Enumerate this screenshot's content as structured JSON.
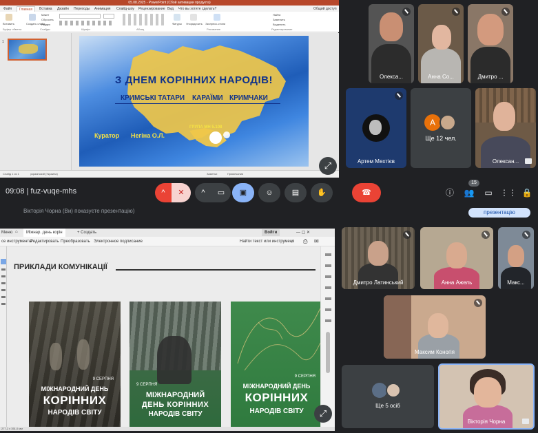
{
  "top": {
    "ppt": {
      "window_title": "05.08.2025 - PowerPoint (Сбой активации продукта)",
      "tabs": [
        "Файл",
        "Главная",
        "Вставка",
        "Дизайн",
        "Переходы",
        "Анимация",
        "Слайд-шоу",
        "Рецензирование",
        "Вид",
        "Что вы хотите сделать?"
      ],
      "share_label": "Общий доступ",
      "ribbon_groups": [
        "Буфер обмена",
        "Слайды",
        "Шрифт",
        "Абзац",
        "Рисование",
        "Редактирование"
      ],
      "ribbon_buttons": [
        "Вставить",
        "Создать слайд",
        "Макет",
        "Сбросить",
        "Раздел",
        "Фигуры",
        "Упорядочить",
        "Экспресс-стили",
        "Найти",
        "Заменить",
        "Выделить"
      ],
      "thumb_number": "1",
      "status_left": "Слайд 1 из 1",
      "status_lang": "украинский (Украина)",
      "status_right": [
        "Заметки",
        "Примечания"
      ]
    },
    "slide": {
      "headline": "З ДНЕМ КОРІННИХ НАРОДІВ!",
      "peoples": [
        "КРИМСЬКІ ТАТАРИ",
        "КАРАЇМИ",
        "КРИМЧАКИ"
      ],
      "group": "ГРУПА МН 5.108",
      "curator_label": "Куратор",
      "curator_name": "Негіна О.Л."
    },
    "participants": [
      {
        "name": "Олекса...",
        "muted": true
      },
      {
        "name": "Анна Со...",
        "muted": true
      },
      {
        "name": "Дмитро ...",
        "muted": true
      },
      {
        "name": "Артем Мехтієв",
        "muted": true
      },
      {
        "name": "Ще 12 чел.",
        "muted": false,
        "avatar_letter": "А"
      },
      {
        "name": "Олексан...",
        "muted": false
      }
    ],
    "controls": {
      "time": "09:08",
      "code": "fuz-vuqe-mhs",
      "people_count": "15"
    }
  },
  "bottom": {
    "banner_text": "Вікторія Чорна (Ви) показуєте презентацію)",
    "stop_present_label": "презентацію",
    "acrobat": {
      "tabs": [
        "Меню",
        "Міжнар. день корін",
        "+ Создать"
      ],
      "sign_in": "Войти",
      "toolbar": [
        "се инструменты",
        "Редактировать",
        "Преобразовать",
        "Электронное подписание"
      ],
      "search": "Найти текст или инструмент",
      "heading": "ПРИКЛАДИ КОМУНІКАЦІЇ",
      "status": "277,2 x 351,0 мм"
    },
    "posters": [
      {
        "date": "9 СЕРПНЯ",
        "line1": "МІЖНАРОДНИЙ ДЕНЬ",
        "line2": "КОРІННИХ",
        "line3": "НАРОДІВ СВІТУ"
      },
      {
        "date": "9 СЕРПНЯ",
        "line1": "МІЖНАРОДНИЙ",
        "line2": "ДЕНЬ КОРІННИХ",
        "line3": "НАРОДІВ СВІТУ"
      },
      {
        "date": "9 СЕРПНЯ",
        "line1": "МІЖНАРОДНИЙ ДЕНЬ",
        "line2": "КОРІННИХ",
        "line3": "НАРОДІВ СВІТУ"
      }
    ],
    "participants": [
      {
        "name": "Дмитро Латинський"
      },
      {
        "name": "Анна Ажель"
      },
      {
        "name": "Макс..."
      },
      {
        "name": "Максим Коногія"
      },
      {
        "name": "Ще 5 осіб"
      },
      {
        "name": "Вікторія Чорна"
      }
    ]
  },
  "colors": {
    "meet_bg": "#202124",
    "tile_bg": "#3c4043",
    "hangup_red": "#ea4335",
    "present_blue": "#8ab4f8",
    "ppt_orange": "#b7472a",
    "slide_yellow": "#f6e343",
    "slide_text": "#10328a"
  },
  "icons": [
    "mic-off-icon",
    "camera-icon",
    "present-icon",
    "emoji-icon",
    "captions-icon",
    "hand-icon",
    "hangup-icon",
    "info-icon",
    "people-icon",
    "chat-icon",
    "apps-icon",
    "lock-icon",
    "expand-icon"
  ]
}
